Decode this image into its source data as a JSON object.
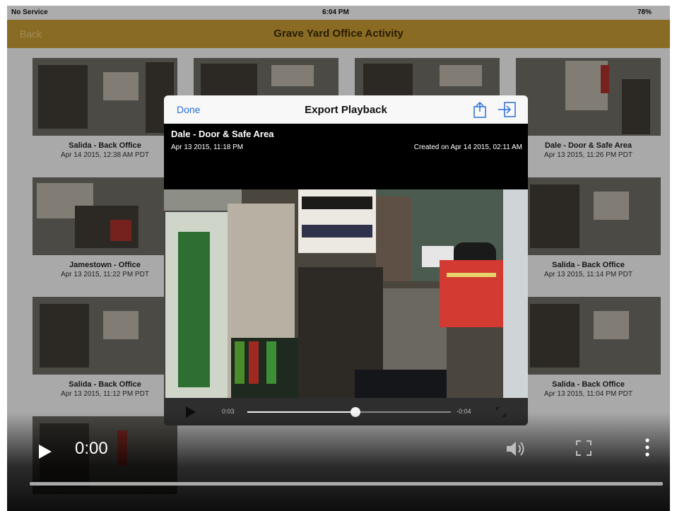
{
  "status_bar": {
    "carrier": "No Service",
    "time": "6:04 PM",
    "battery": "78%"
  },
  "nav": {
    "back_label": "Back",
    "title": "Grave Yard Office Activity"
  },
  "tiles": [
    {
      "title": "Salida - Back Office",
      "date": "Apr 14 2015, 12:38 AM PDT"
    },
    {
      "title": "",
      "date": ""
    },
    {
      "title": "",
      "date": ""
    },
    {
      "title": "Dale - Door & Safe Area",
      "date": "Apr 13 2015, 11:26 PM PDT"
    },
    {
      "title": "Jamestown - Office",
      "date": "Apr 13 2015, 11:22 PM PDT"
    },
    {
      "title": "Salida - Back Office",
      "date": "Apr 13 2015, 11:14 PM PDT"
    },
    {
      "title": "Salida - Back Office",
      "date": "Apr 13 2015, 11:12 PM PDT"
    },
    {
      "title": "Salida - Back Office",
      "date": "Apr 13 2015, 11:04 PM PDT"
    },
    {
      "title": "",
      "date": ""
    }
  ],
  "modal": {
    "done_label": "Done",
    "title": "Export Playback",
    "camera_name": "Dale - Door & Safe Area",
    "recorded": "Apr 13 2015, 11:18 PM",
    "created": "Created on Apr 14 2015, 02:11 AM",
    "time_elapsed": "0:03",
    "time_remaining": "-0:04",
    "progress": 0.53
  },
  "player": {
    "time": "0:00",
    "progress": 0.0
  },
  "icons": {
    "share": "share-icon",
    "exit": "exit-icon",
    "play": "play-icon",
    "expand": "expand-icon",
    "volume": "volume-icon",
    "fullscreen": "fullscreen-icon",
    "more": "more-vertical-icon"
  },
  "colors": {
    "nav_bar": "#c69a33",
    "accent": "#2b6fd6",
    "vest": "#d23a32"
  }
}
